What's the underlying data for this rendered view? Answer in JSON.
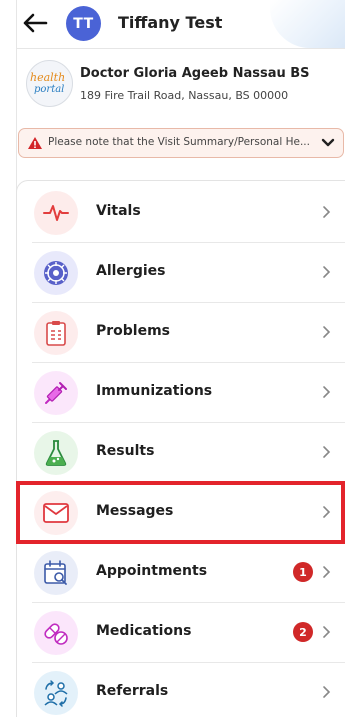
{
  "header": {
    "back_icon": "arrow-left-icon",
    "avatar_initials": "TT",
    "avatar_color": "#4a63d6",
    "user_name": "Tiffany Test"
  },
  "provider": {
    "logo_text_top": "health",
    "logo_text_bottom": "portal",
    "name": "Doctor Gloria Ageeb Nassau BS",
    "address": "189 Fire Trail Road, Nassau, BS 00000"
  },
  "notice": {
    "icon": "warning-icon",
    "text": "Please note that the Visit Summary/Personal He...",
    "chevron_icon": "chevron-down-icon"
  },
  "menu": {
    "items": [
      {
        "label": "Vitals",
        "icon": "heartbeat-icon",
        "badge": ""
      },
      {
        "label": "Allergies",
        "icon": "allergen-icon",
        "badge": ""
      },
      {
        "label": "Problems",
        "icon": "clipboard-icon",
        "badge": ""
      },
      {
        "label": "Immunizations",
        "icon": "syringe-icon",
        "badge": ""
      },
      {
        "label": "Results",
        "icon": "flask-icon",
        "badge": ""
      },
      {
        "label": "Messages",
        "icon": "envelope-icon",
        "badge": ""
      },
      {
        "label": "Appointments",
        "icon": "calendar-search-icon",
        "badge": "1"
      },
      {
        "label": "Medications",
        "icon": "pills-icon",
        "badge": "2"
      },
      {
        "label": "Referrals",
        "icon": "referral-icon",
        "badge": ""
      }
    ],
    "highlighted_item": "Messages",
    "highlight_color": "#e3242b",
    "badge_color": "#d02828"
  }
}
